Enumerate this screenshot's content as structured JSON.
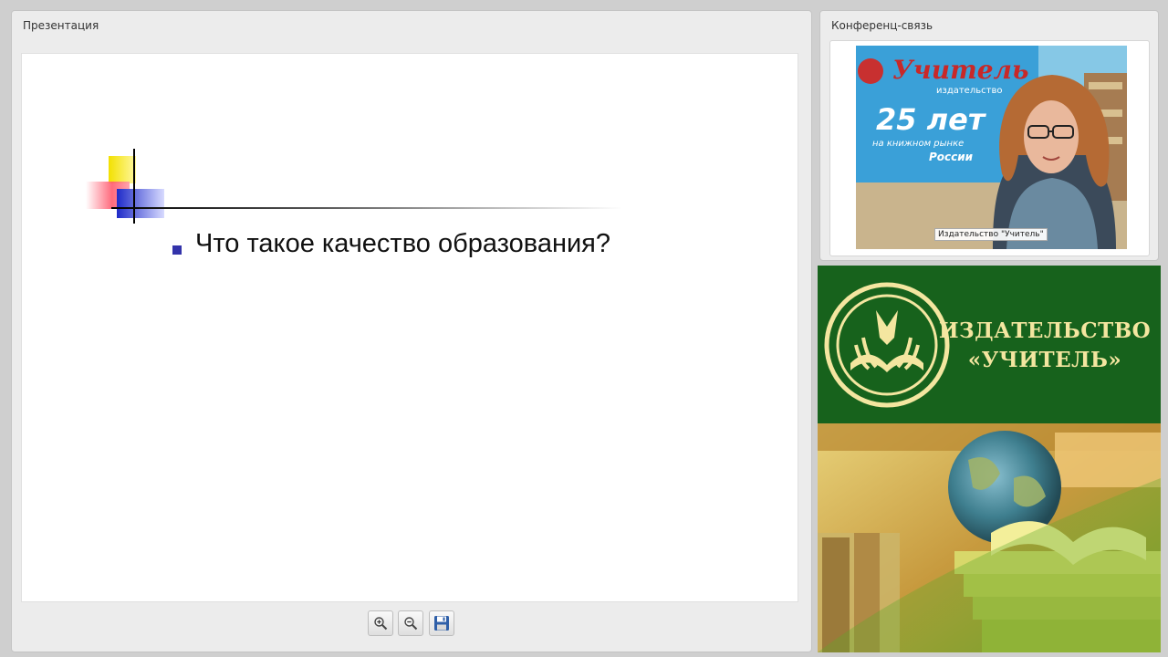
{
  "presentation": {
    "title": "Презентация",
    "slide": {
      "bullet": "Что такое качество образования?"
    },
    "toolbar": {
      "zoom_in_icon": "zoom-in-icon",
      "zoom_out_icon": "zoom-out-icon",
      "save_icon": "save-icon"
    }
  },
  "conference": {
    "title": "Конференц-связь",
    "participant_label": "Издательство \"Учитель\"",
    "background_sign": {
      "line1": "Учитель",
      "line2": "издательство",
      "years": "25 лет",
      "line3": "на книжном рынке",
      "line4": "России"
    }
  },
  "banner": {
    "name_line1": "ИЗДАТЕЛЬСТВО",
    "name_line2": "«УЧИТЕЛЬ»",
    "colors": {
      "green": "#17621c",
      "gold": "#f4e6a0"
    }
  }
}
